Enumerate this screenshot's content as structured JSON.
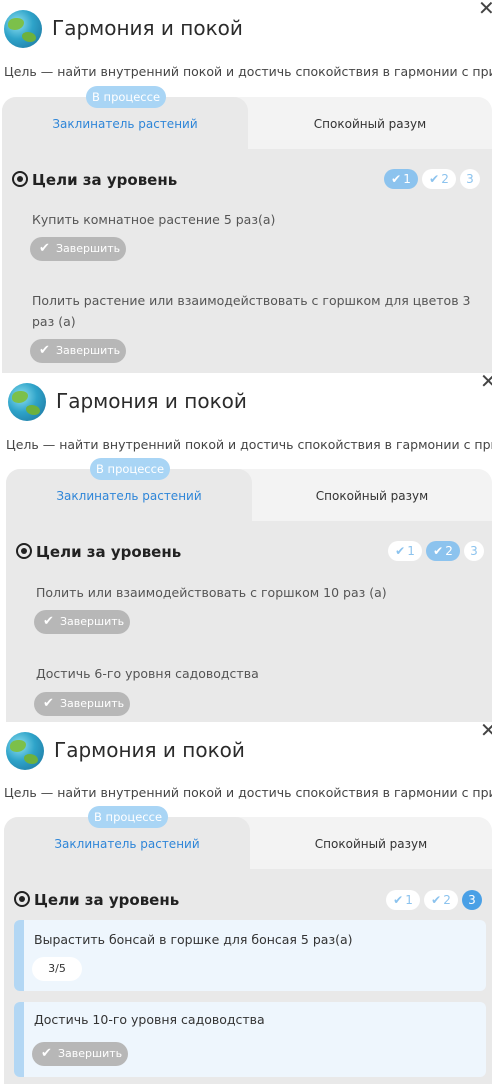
{
  "panels": [
    {
      "close_label": "✕",
      "title": "Гармония и покой",
      "subtitle": "Цель — найти внутренний покой и достичь спокойствия в гармонии с природой",
      "badge": "В процессе",
      "tab_active": "Заклинатель растений",
      "tab_inactive": "Спокойный разум",
      "goals_title": "Цели за уровень",
      "levels": [
        "1",
        "2",
        "3"
      ],
      "tasks": [
        {
          "text": "Купить комнатное растение 5 раз(а)",
          "button": "Завершить"
        },
        {
          "text": "Полить растение или взаимодействовать с горшком для цветов 3 раз (а)",
          "button": "Завершить"
        }
      ]
    },
    {
      "close_label": "✕",
      "title": "Гармония и покой",
      "subtitle": "Цель — найти внутренний покой и достичь спокойствия в гармонии с природой",
      "badge": "В процессе",
      "tab_active": "Заклинатель растений",
      "tab_inactive": "Спокойный разум",
      "goals_title": "Цели за уровень",
      "levels": [
        "1",
        "2",
        "3"
      ],
      "tasks": [
        {
          "text": "Полить или взаимодействовать с горшком 10 раз (а)",
          "button": "Завершить"
        },
        {
          "text": "Достичь 6-го уровня садоводства",
          "button": "Завершить"
        }
      ]
    },
    {
      "close_label": "✕",
      "title": "Гармония и покой",
      "subtitle": "Цель — найти внутренний покой и достичь спокойствия в гармонии с природой",
      "badge": "В процессе",
      "tab_active": "Заклинатель растений",
      "tab_inactive": "Спокойный разум",
      "goals_title": "Цели за уровень",
      "levels": [
        "1",
        "2",
        "3"
      ],
      "tasks": [
        {
          "text": "Вырастить бонсай в горшке для бонсая 5 раз(а)",
          "progress": "3/5"
        },
        {
          "text": "Достичь 10-го уровня садоводства",
          "button": "Завершить"
        }
      ]
    }
  ],
  "icons": {
    "check": "✔",
    "dove": "🕊"
  },
  "colors": {
    "accent": "#2f86d8",
    "badge": "#a9d5f5",
    "level_done": "#8cc3ee",
    "level_current": "#4aa0e6",
    "button_disabled": "#b7b7b7",
    "card_bg": "#eef6fd"
  }
}
